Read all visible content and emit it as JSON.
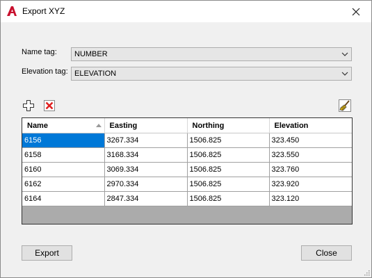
{
  "window": {
    "title": "Export XYZ",
    "app_icon": "autocad-logo-icon",
    "close_icon": "close-icon"
  },
  "form": {
    "name_tag_label": "Name tag:",
    "name_tag_value": "NUMBER",
    "elevation_tag_label": "Elevation tag:",
    "elevation_tag_value": "ELEVATION"
  },
  "toolbar": {
    "add_icon": "add-icon",
    "delete_icon": "delete-icon",
    "clear_icon": "broom-icon"
  },
  "grid": {
    "columns": [
      "Name",
      "Easting",
      "Northing",
      "Elevation"
    ],
    "sort_column": "Name",
    "sort_direction": "ascending",
    "rows": [
      [
        "6156",
        "3267.334",
        "1506.825",
        "323.450"
      ],
      [
        "6158",
        "3168.334",
        "1506.825",
        "323.550"
      ],
      [
        "6160",
        "3069.334",
        "1506.825",
        "323.760"
      ],
      [
        "6162",
        "2970.334",
        "1506.825",
        "323.920"
      ],
      [
        "6164",
        "2847.334",
        "1506.825",
        "323.120"
      ]
    ],
    "selected_row": 0
  },
  "buttons": {
    "export_label": "Export",
    "close_label": "Close"
  },
  "colors": {
    "selection": "#0078d7",
    "app_icon_red": "#c8102e",
    "delete_red": "#e02020"
  }
}
